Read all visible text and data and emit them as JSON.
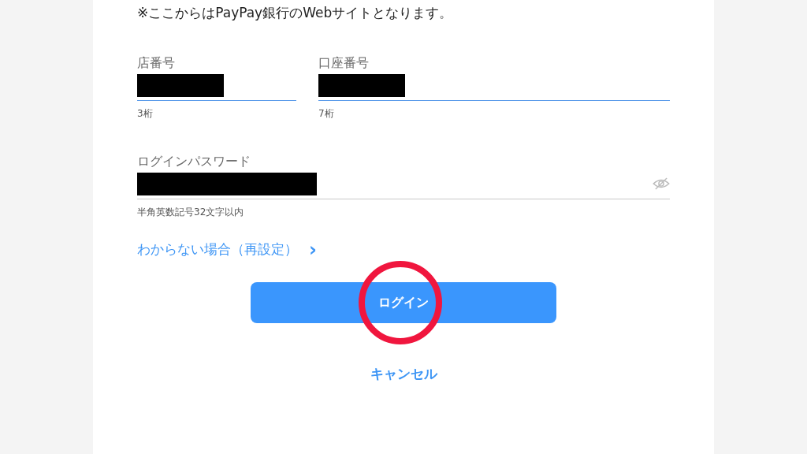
{
  "notice": "※ここからはPayPay銀行のWebサイトとなります。",
  "fields": [
    {
      "label": "店番号",
      "hint": "3桁",
      "redacted": true,
      "highlighted": true,
      "kind": "text"
    },
    {
      "label": "口座番号",
      "hint": "7桁",
      "redacted": true,
      "highlighted": true,
      "kind": "text"
    },
    {
      "label": "ログインパスワード",
      "hint": "半角英数記号32文字以内",
      "redacted": true,
      "highlighted": false,
      "kind": "password"
    }
  ],
  "help_link": {
    "label": "わからない場合（再設定）",
    "chevron": "›"
  },
  "login_button": {
    "label": "ログイン",
    "circled": true
  },
  "cancel_link": "キャンセル"
}
